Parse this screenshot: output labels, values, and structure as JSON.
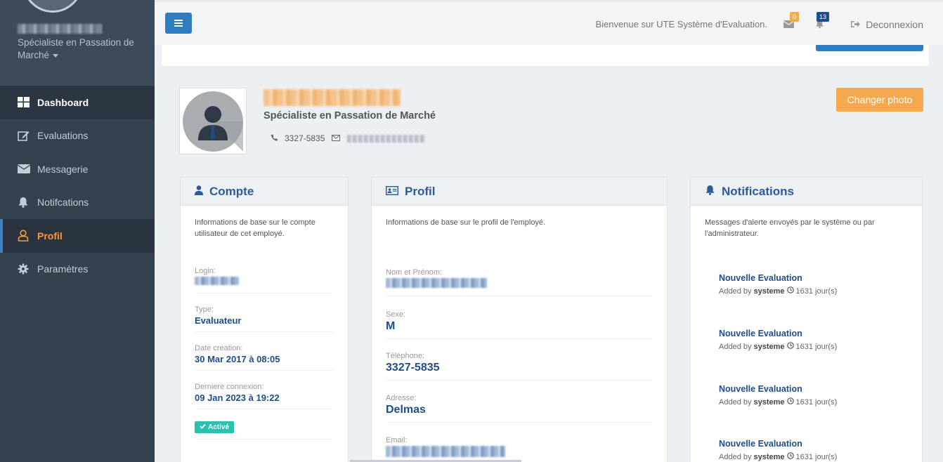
{
  "sidebar": {
    "user_role": "Spécialiste en Passation de Marché",
    "items": [
      {
        "label": "Dashboard",
        "icon": "dashboard-icon"
      },
      {
        "label": "Evaluations",
        "icon": "edit-icon"
      },
      {
        "label": "Messagerie",
        "icon": "envelope-icon"
      },
      {
        "label": "Notifcations",
        "icon": "bell-icon"
      },
      {
        "label": "Profil",
        "icon": "user-icon"
      },
      {
        "label": "Paramètres",
        "icon": "gear-icon"
      }
    ]
  },
  "topbar": {
    "welcome": "Bienvenue sur UTE Système d'Evaluation.",
    "mail_count": "0",
    "notif_count": "13",
    "logout_label": "Deconnexion"
  },
  "profile": {
    "role": "Spécialiste en Passation de Marché",
    "phone": "3327-5835",
    "change_photo_label": "Changer photo"
  },
  "compte": {
    "title": "Compte",
    "description": "Informations de base sur le compte utilisateur de cet employé.",
    "login_label": "Login:",
    "type_label": "Type:",
    "type_value": "Evaluateur",
    "date_creation_label": "Date creation:",
    "date_creation_value": "30 Mar 2017 à 08:05",
    "derniere_connexion_label": "Derniere connexion:",
    "derniere_connexion_value": "09 Jan 2023 à 19:22",
    "status": "Activé"
  },
  "profil": {
    "title": "Profil",
    "description": "Informations de base sur le profil de l'employé.",
    "nom_label": "Nom et Prénom:",
    "sexe_label": "Sexe:",
    "sexe_value": "M",
    "telephone_label": "Téléphone:",
    "telephone_value": "3327-5835",
    "adresse_label": "Adresse:",
    "adresse_value": "Delmas",
    "email_label": "Email:"
  },
  "notifications": {
    "title": "Notifications",
    "description": "Messages d'alerte envoyés par le système ou par l'administrateur.",
    "items": [
      {
        "title": "Nouvelle Evaluation",
        "added_by": "Added by",
        "author": "systeme",
        "age": "1631 jour(s)"
      },
      {
        "title": "Nouvelle Evaluation",
        "added_by": "Added by",
        "author": "systeme",
        "age": "1631 jour(s)"
      },
      {
        "title": "Nouvelle Evaluation",
        "added_by": "Added by",
        "author": "systeme",
        "age": "1631 jour(s)"
      },
      {
        "title": "Nouvelle Evaluation",
        "added_by": "Added by",
        "author": "systeme",
        "age": "1631 jour(s)"
      }
    ]
  }
}
